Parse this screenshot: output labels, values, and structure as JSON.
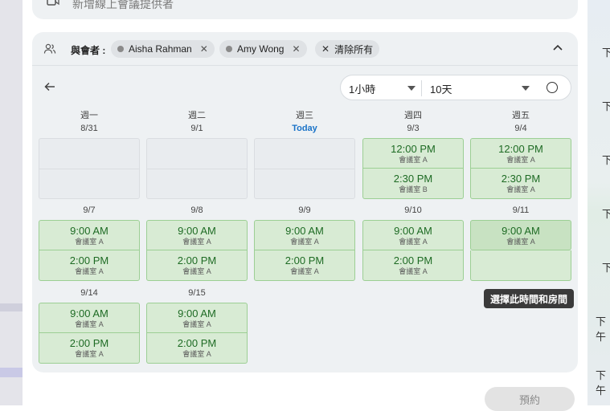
{
  "top_card": {
    "text": "新增線上會議提供者"
  },
  "attendees": {
    "label": "與會者 :",
    "chips": [
      {
        "name": "Aisha Rahman"
      },
      {
        "name": "Amy Wong"
      }
    ],
    "clear_label": "清除所有"
  },
  "controls": {
    "duration": "1小時",
    "range": "10天"
  },
  "weekdays": [
    "週一",
    "週二",
    "週三",
    "週四",
    "週五"
  ],
  "weeks": [
    {
      "days": [
        {
          "date": "8/31",
          "today": false,
          "slots": []
        },
        {
          "date": "9/1",
          "today": false,
          "slots": []
        },
        {
          "date": "Today",
          "today": true,
          "slots": []
        },
        {
          "date": "9/3",
          "today": false,
          "slots": [
            {
              "time": "12:00 PM",
              "room": "會議室 A"
            },
            {
              "time": "2:30 PM",
              "room": "會議室 B"
            }
          ]
        },
        {
          "date": "9/4",
          "today": false,
          "slots": [
            {
              "time": "12:00 PM",
              "room": "會議室 A"
            },
            {
              "time": "2:30 PM",
              "room": "會議室 A"
            }
          ]
        }
      ]
    },
    {
      "days": [
        {
          "date": "9/7",
          "slots": [
            {
              "time": "9:00 AM",
              "room": "會議室 A"
            },
            {
              "time": "2:00 PM",
              "room": "會議室 A"
            }
          ]
        },
        {
          "date": "9/8",
          "slots": [
            {
              "time": "9:00 AM",
              "room": "會議室 A"
            },
            {
              "time": "2:00 PM",
              "room": "會議室 A"
            }
          ]
        },
        {
          "date": "9/9",
          "slots": [
            {
              "time": "9:00 AM",
              "room": "會議室 A"
            },
            {
              "time": "2:00 PM",
              "room": "會議室 A"
            }
          ]
        },
        {
          "date": "9/10",
          "slots": [
            {
              "time": "9:00 AM",
              "room": "會議室 A"
            },
            {
              "time": "2:00 PM",
              "room": "會議室 A"
            }
          ]
        },
        {
          "date": "9/11",
          "slots": [
            {
              "time": "9:00 AM",
              "room": "會議室 A"
            }
          ]
        }
      ]
    },
    {
      "days": [
        {
          "date": "9/14",
          "slots": [
            {
              "time": "9:00 AM",
              "room": "會議室 A"
            },
            {
              "time": "2:00 PM",
              "room": "會議室 A"
            }
          ]
        },
        {
          "date": "9/15",
          "slots": [
            {
              "time": "9:00 AM",
              "room": "會議室 A"
            },
            {
              "time": "2:00 PM",
              "room": "會議室 A"
            }
          ]
        }
      ]
    }
  ],
  "tooltip": "選擇此時間和房間",
  "book_button": "預約",
  "background_labels": [
    "下",
    "下",
    "下",
    "下",
    "下",
    "下午",
    "下午"
  ]
}
